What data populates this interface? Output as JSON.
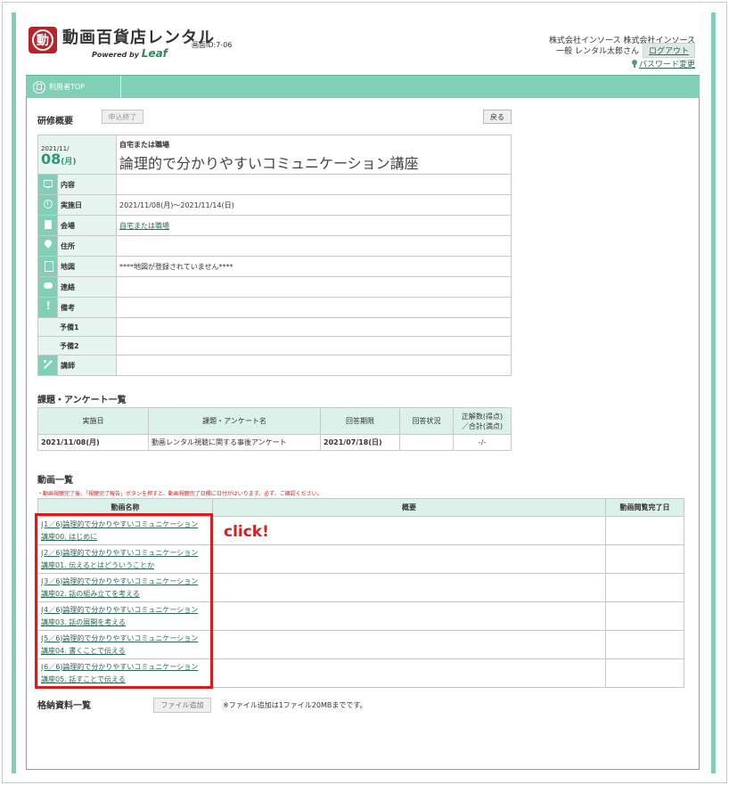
{
  "header": {
    "brand": "動画百貨店レンタル",
    "powered_prefix": "Powered by",
    "powered_leaf": "Leaf",
    "screen_id": "画面ID:7-06",
    "company": "株式会社インソース 株式会社インソース",
    "user": "一般  レンタル太郎さん",
    "logout": "ログアウト",
    "password_change": "パスワード変更"
  },
  "tabs": [
    {
      "label": "利用者TOP"
    }
  ],
  "overview": {
    "title": "研修概要",
    "btn_closed": "申込終了",
    "btn_back": "戻る",
    "date_small": "2021/11/",
    "date_big": "08",
    "date_dow": "(月)",
    "place": "自宅または職場",
    "course_title": "論理的で分かりやすいコミュニケーション講座",
    "rows": [
      {
        "label": "内容",
        "value": ""
      },
      {
        "label": "実施日",
        "value": "2021/11/08(月)〜2021/11/14(日)"
      },
      {
        "label": "会場",
        "value": "自宅または職場"
      },
      {
        "label": "住所",
        "value": ""
      },
      {
        "label": "地図",
        "value": "****地図が登録されていません****"
      },
      {
        "label": "連絡",
        "value": ""
      },
      {
        "label": "備考",
        "value": ""
      },
      {
        "label": "予備1",
        "value": ""
      },
      {
        "label": "予備2",
        "value": ""
      },
      {
        "label": "講師",
        "value": ""
      }
    ]
  },
  "survey": {
    "title": "課題・アンケート一覧",
    "headers": [
      "実施日",
      "課題・アンケート名",
      "回答期限",
      "回答状況",
      "正解数(得点)／合計(満点)"
    ],
    "header_score_l1": "正解数(得点)",
    "header_score_l2": "／合計(満点)",
    "rows": [
      {
        "date": "2021/11/08(月)",
        "name": "動画レンタル視聴に関する事後アンケート",
        "deadline": "2021/07/18(日)",
        "status": "",
        "score": "-/-"
      }
    ]
  },
  "videos": {
    "title": "動画一覧",
    "note": "・動画視聴完了後、「視聴完了報告」ボタンを押すと、動画視聴完了日欄に日付がはいります。必ず、ご確認ください。",
    "headers": [
      "動画名称",
      "概要",
      "動画閲覧完了日"
    ],
    "rows": [
      {
        "l1": "(1／6)論理的で分かりやすいコミュニケーション",
        "l2": "講座00. はじめに"
      },
      {
        "l1": "(2／6)論理的で分かりやすいコミュニケーション",
        "l2": "講座01. 伝えるとはどういうことか"
      },
      {
        "l1": "(3／6)論理的で分かりやすいコミュニケーション",
        "l2": "講座02. 話の組み立てを考える"
      },
      {
        "l1": "(4／6)論理的で分かりやすいコミュニケーション",
        "l2": "講座03. 話の展開を考える"
      },
      {
        "l1": "(5／6)論理的で分かりやすいコミュニケーション",
        "l2": "講座04. 書くことで伝える"
      },
      {
        "l1": "(6／6)論理的で分かりやすいコミュニケーション",
        "l2": "講座05. 話すことで伝える"
      }
    ],
    "annotation": "click!"
  },
  "files": {
    "title": "格納資料一覧",
    "btn_add": "ファイル追加",
    "note": "※ファイル追加は1ファイル20MBまでです。"
  },
  "colors": {
    "accent": "#7fd0b6",
    "link": "#2a6a50",
    "date": "#2a9a70",
    "alert": "#e01a1a"
  }
}
